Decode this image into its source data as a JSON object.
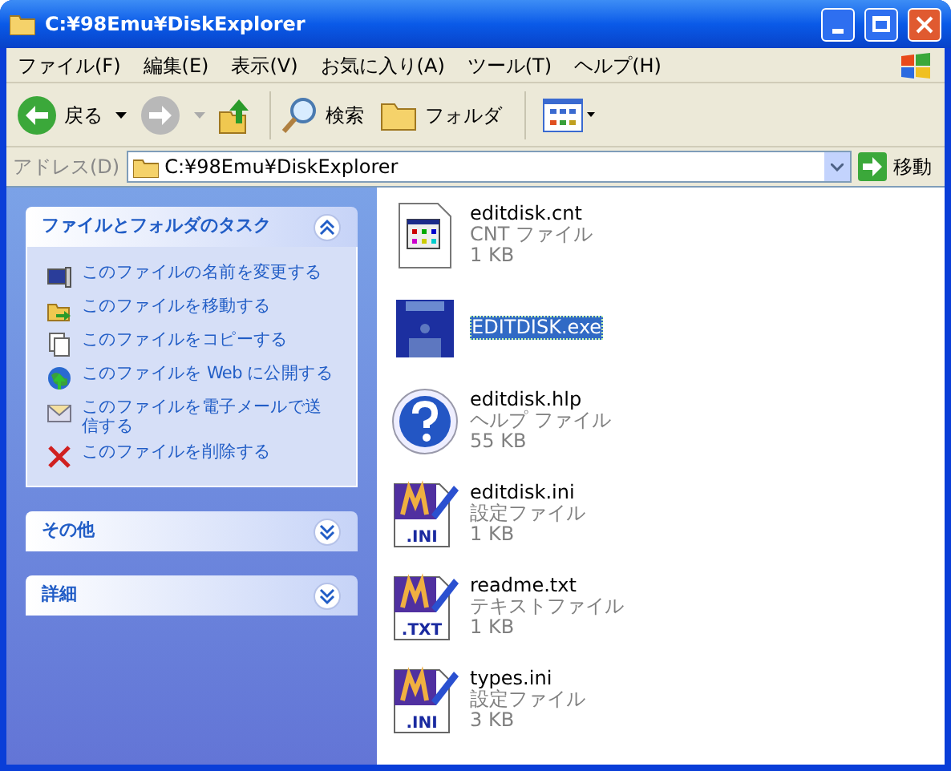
{
  "window": {
    "title": "C:¥98Emu¥DiskExplorer"
  },
  "menu": [
    "ファイル(F)",
    "編集(E)",
    "表示(V)",
    "お気に入り(A)",
    "ツール(T)",
    "ヘルプ(H)"
  ],
  "toolbar": {
    "back": "戻る",
    "search": "検索",
    "folders": "フォルダ"
  },
  "address": {
    "label": "アドレス(D)",
    "value": "C:¥98Emu¥DiskExplorer",
    "go": "移動"
  },
  "panels": [
    {
      "title": "ファイルとフォルダのタスク",
      "expanded": true,
      "items": [
        {
          "kind": "rename",
          "label": "このファイルの名前を変更する"
        },
        {
          "kind": "move",
          "label": "このファイルを移動する"
        },
        {
          "kind": "copy",
          "label": "このファイルをコピーする"
        },
        {
          "kind": "web",
          "label": "このファイルを Web に公開する"
        },
        {
          "kind": "mail",
          "label": "このファイルを電子メールで送信する"
        },
        {
          "kind": "delete",
          "label": "このファイルを削除する"
        }
      ]
    },
    {
      "title": "その他",
      "expanded": false
    },
    {
      "title": "詳細",
      "expanded": false
    }
  ],
  "files": [
    {
      "kind": "cnt",
      "name": "editdisk.cnt",
      "type": "CNT ファイル",
      "size": "1 KB",
      "selected": false
    },
    {
      "kind": "exe",
      "name": "EDITDISK.exe",
      "selected": true
    },
    {
      "kind": "hlp",
      "name": "editdisk.hlp",
      "type": "ヘルプ ファイル",
      "size": "55 KB",
      "selected": false
    },
    {
      "kind": "doc",
      "badge": ".INI",
      "name": "editdisk.ini",
      "type": "設定ファイル",
      "size": "1 KB",
      "selected": false
    },
    {
      "kind": "doc",
      "badge": ".TXT",
      "name": "readme.txt",
      "type": "テキストファイル",
      "size": "1 KB",
      "selected": false
    },
    {
      "kind": "doc",
      "badge": ".INI",
      "name": "types.ini",
      "type": "設定ファイル",
      "size": "3 KB",
      "selected": false
    }
  ]
}
